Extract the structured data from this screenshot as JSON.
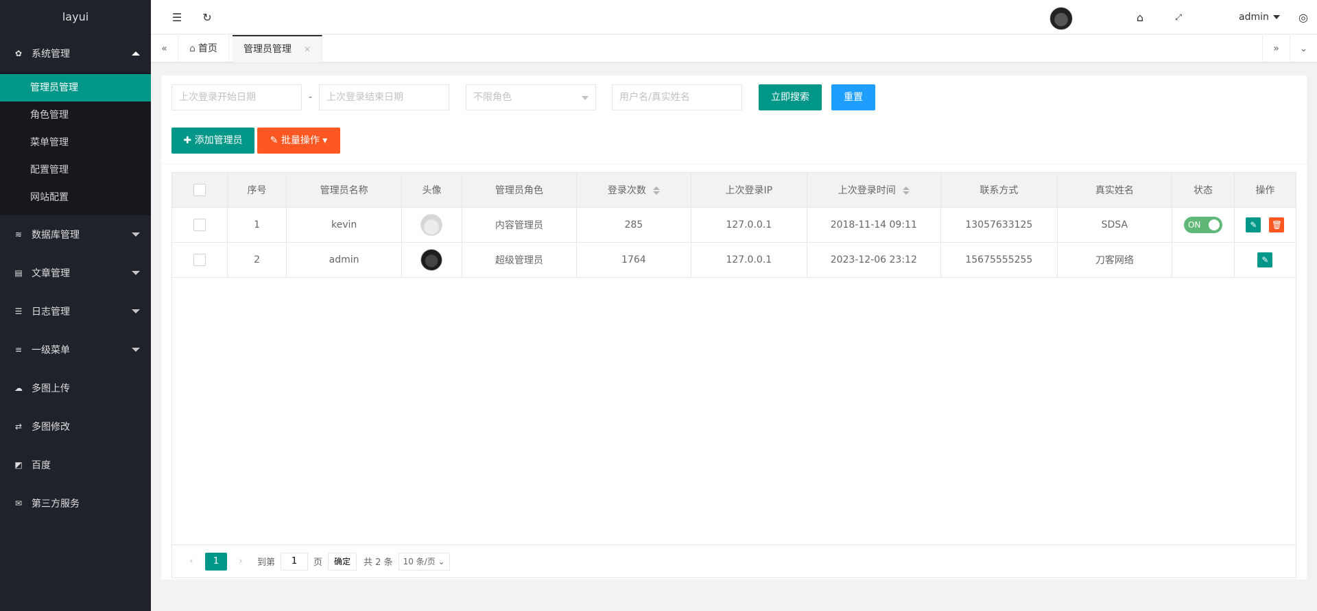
{
  "sidebar": {
    "logo": "layui",
    "groups": [
      {
        "label": "系统管理",
        "icon": "gear-icon",
        "expanded": true,
        "items": [
          {
            "label": "管理员管理",
            "active": true
          },
          {
            "label": "角色管理"
          },
          {
            "label": "菜单管理"
          },
          {
            "label": "配置管理"
          },
          {
            "label": "网站配置"
          }
        ]
      },
      {
        "label": "数据库管理",
        "icon": "database-icon"
      },
      {
        "label": "文章管理",
        "icon": "article-icon"
      },
      {
        "label": "日志管理",
        "icon": "log-icon"
      },
      {
        "label": "一级菜单",
        "icon": "list-icon"
      },
      {
        "label": "多图上传",
        "icon": "cloud-upload-icon"
      },
      {
        "label": "多图修改",
        "icon": "exchange-icon"
      },
      {
        "label": "百度",
        "icon": "external-link-icon"
      },
      {
        "label": "第三方服务",
        "icon": "envelope-icon"
      }
    ]
  },
  "header": {
    "user": "admin",
    "icons": [
      "menu-toggle-icon",
      "refresh-icon",
      "tag-icon",
      "fullscreen-icon",
      "theme-icon"
    ]
  },
  "tabs": {
    "home": "首页",
    "current": "管理员管理"
  },
  "filters": {
    "start_date_placeholder": "上次登录开始日期",
    "end_date_placeholder": "上次登录结束日期",
    "separator": "-",
    "role_placeholder": "不限角色",
    "keyword_placeholder": "用户名/真实姓名",
    "search_label": "立即搜索",
    "reset_label": "重置"
  },
  "toolbar": {
    "add_label": "添加管理员",
    "batch_label": "批量操作"
  },
  "table": {
    "headers": [
      "序号",
      "管理员名称",
      "头像",
      "管理员角色",
      "登录次数",
      "上次登录IP",
      "上次登录时间",
      "联系方式",
      "真实姓名",
      "状态",
      "操作"
    ],
    "rows": [
      {
        "no": "1",
        "name": "kevin",
        "role": "内容管理员",
        "logins": "285",
        "ip": "127.0.0.1",
        "time": "2018-11-14 09:11",
        "phone": "13057633125",
        "real_name": "SDSA",
        "status": "ON"
      },
      {
        "no": "2",
        "name": "admin",
        "role": "超级管理员",
        "logins": "1764",
        "ip": "127.0.0.1",
        "time": "2023-12-06 23:12",
        "phone": "15675555255",
        "real_name": "刀客网络",
        "status": ""
      }
    ]
  },
  "pager": {
    "current": "1",
    "goto_label": "到第",
    "page_value": "1",
    "page_unit": "页",
    "confirm": "确定",
    "total": "共 2 条",
    "per_page": "10 条/页"
  },
  "colors": {
    "accent": "#009688",
    "blue": "#1e9fff",
    "orange": "#ff5722",
    "sidebar": "#20222a",
    "switch_on": "#5fb878"
  }
}
